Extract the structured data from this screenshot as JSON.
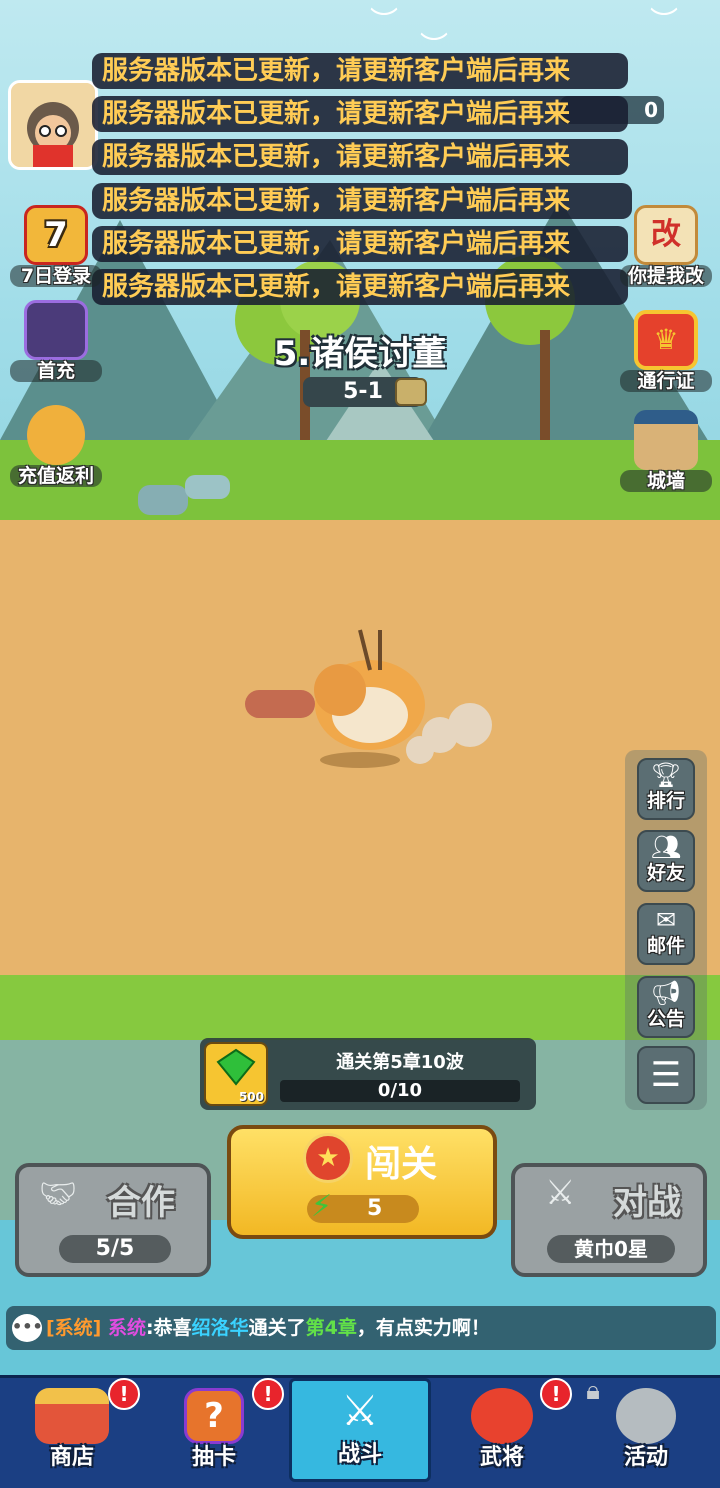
{
  "notifications": [
    "服务器版本已更新，请更新客户端后再来",
    "服务器版本已更新，请更新客户端后再来",
    "服务器版本已更新，请更新客户端后再来",
    "服务器版本已更新，请更新客户端后再来",
    "服务器版本已更新，请更新客户端后再来",
    "服务器版本已更新，请更新客户端后再来"
  ],
  "player": {
    "currency_value": "0",
    "avatar_icon": "avatar-icon"
  },
  "left_buttons": [
    {
      "label": "7日登录",
      "icon": "gift-box-icon"
    },
    {
      "label": "首充",
      "icon": "armored-hero-icon"
    },
    {
      "label": "充值返利",
      "icon": "money-bag-icon"
    }
  ],
  "right_top_buttons": [
    {
      "label": "你提我改",
      "icon": "feedback-scroll-icon"
    },
    {
      "label": "通行证",
      "icon": "pass-crown-icon"
    },
    {
      "label": "城墙",
      "icon": "city-wall-icon"
    }
  ],
  "stage": {
    "chapter_title": "5.诸侯讨董",
    "level": "5-1"
  },
  "right_side_buttons": [
    {
      "label": "排行",
      "icon": "trophy-icon"
    },
    {
      "label": "好友",
      "icon": "friends-icon"
    },
    {
      "label": "邮件",
      "icon": "mail-icon"
    },
    {
      "label": "公告",
      "icon": "megaphone-icon"
    },
    {
      "label": "",
      "icon": "menu-icon"
    }
  ],
  "reward": {
    "gem_amount": "500",
    "task_text": "通关第5章10波",
    "progress_text": "0/10",
    "progress": 0.0
  },
  "actions": {
    "coop": {
      "label": "合作",
      "sub": "5/5"
    },
    "challenge": {
      "label": "闯关",
      "energy_cost": "5"
    },
    "battle": {
      "label": "对战",
      "sub": "黄巾0星"
    }
  },
  "chat": {
    "channel": "[系统]",
    "sender": "系统",
    "msg_a": ":恭喜",
    "player_name": "绍洛华",
    "msg_b": "通关了",
    "chapter": "第4章",
    "msg_c": "，有点实力啊！"
  },
  "nav": [
    {
      "label": "商店",
      "icon": "shop-icon",
      "badge": "!"
    },
    {
      "label": "抽卡",
      "icon": "card-draw-icon",
      "badge": "!"
    },
    {
      "label": "战斗",
      "icon": "battle-swords-icon",
      "badge": ""
    },
    {
      "label": "武将",
      "icon": "general-icon",
      "badge": "!"
    },
    {
      "label": "活动",
      "icon": "activity-icon",
      "badge": "locked"
    }
  ],
  "colors": {
    "notice_text": "#ffcc55",
    "accent_yellow": "#f6c531",
    "nav_bg": "#1b3f83",
    "active_tab": "#36b8e0"
  }
}
